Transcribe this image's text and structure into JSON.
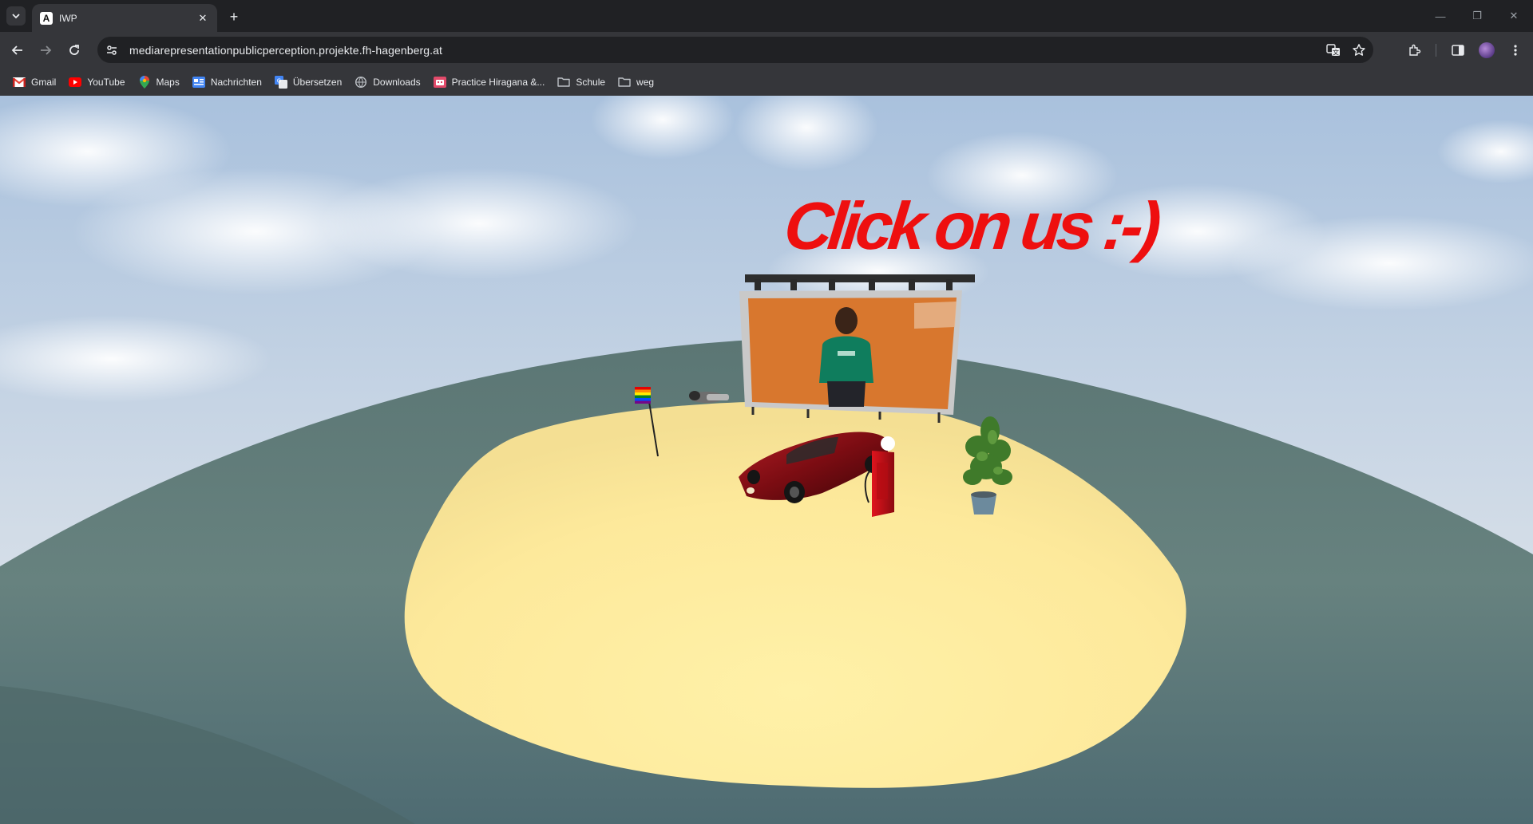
{
  "browser": {
    "tab": {
      "title": "IWP",
      "favicon_letter": "A"
    },
    "url": "mediarepresentationpublicperception.projekte.fh-hagenberg.at",
    "bookmarks": [
      {
        "label": "Gmail",
        "icon": "gmail-icon"
      },
      {
        "label": "YouTube",
        "icon": "youtube-icon"
      },
      {
        "label": "Maps",
        "icon": "maps-icon"
      },
      {
        "label": "Nachrichten",
        "icon": "news-icon"
      },
      {
        "label": "Übersetzen",
        "icon": "translate-icon"
      },
      {
        "label": "Downloads",
        "icon": "downloads-icon"
      },
      {
        "label": "Practice Hiragana &...",
        "icon": "hiragana-icon"
      },
      {
        "label": "Schule",
        "icon": "folder-icon"
      },
      {
        "label": "weg",
        "icon": "folder-icon"
      }
    ]
  },
  "scene": {
    "headline": "Click on us :-)",
    "colors": {
      "headline": "#ee0f0f",
      "sky_top": "#a9c1dd",
      "sky_bottom": "#dfe6ee",
      "ground": "#5f7b79",
      "sand": "#fde99b",
      "billboard_bg": "#d8772e",
      "car": "#7a0c12"
    }
  }
}
